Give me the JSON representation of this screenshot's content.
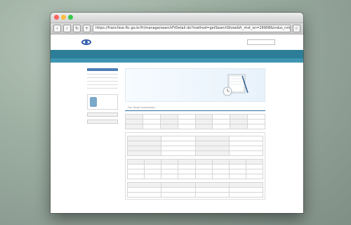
{
  "window": {
    "title": "",
    "url": "https://franchise.ftc.go.kr/fr/manage/searchFrDetail.do?method=getSearchShow&fr_mst_sn=29908&indus_nm=???&st=ft"
  },
  "site": {
    "logo_text": "",
    "util_links": [
      "",
      "",
      "",
      ""
    ],
    "search_placeholder": ""
  },
  "gnb": [
    "",
    "",
    "",
    "",
    ""
  ],
  "subnav": [
    "",
    "",
    "",
    ""
  ],
  "lnb": {
    "title": "",
    "items": [
      "",
      "",
      "",
      "",
      ""
    ]
  },
  "app_box": {
    "title": "",
    "desc": ""
  },
  "side_buttons": [
    "",
    ""
  ],
  "banner": {
    "line1": "",
    "line2": "",
    "line3": ""
  },
  "page_head": {
    "title": "",
    "subtitle": "Fair Trade Commission",
    "breadcrumb": ""
  },
  "notice": "",
  "section1": {
    "title": "",
    "rows": [
      [
        "",
        "",
        "",
        "",
        "",
        "",
        "",
        ""
      ],
      [
        "",
        "",
        "",
        "",
        "",
        "",
        "",
        ""
      ],
      [
        "",
        "",
        "",
        "",
        "",
        "",
        "",
        ""
      ]
    ]
  },
  "section2": {
    "title": "",
    "rows": [
      [
        "",
        "",
        "",
        ""
      ],
      [
        "",
        "",
        "",
        ""
      ],
      [
        "",
        "",
        "",
        ""
      ],
      [
        "",
        "",
        "",
        ""
      ]
    ]
  },
  "section3": {
    "title": "",
    "header": [
      "",
      "",
      "",
      "",
      "",
      "",
      "",
      ""
    ],
    "rows": [
      [
        "",
        "",
        "",
        "",
        "",
        "",
        "",
        ""
      ],
      [
        "",
        "",
        "",
        "",
        "",
        "",
        "",
        ""
      ],
      [
        "",
        "",
        "",
        "",
        "",
        "",
        "",
        ""
      ]
    ]
  },
  "section4": {
    "title": "",
    "header": [
      "",
      "",
      "",
      ""
    ],
    "rows": [
      [
        "",
        "",
        "",
        ""
      ],
      [
        "",
        "",
        "",
        ""
      ]
    ]
  }
}
